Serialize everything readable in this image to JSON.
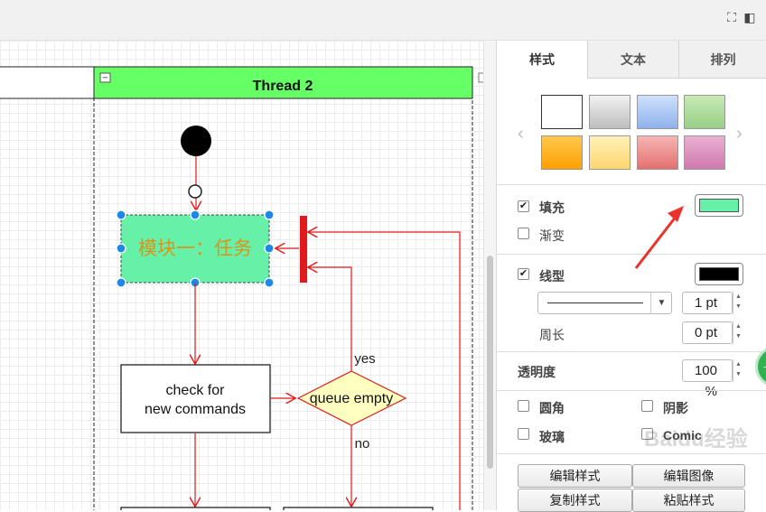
{
  "toolbar": {
    "fullscreen_icon": "fullscreen-icon",
    "panel_toggle_icon": "panel-toggle-icon"
  },
  "diagram": {
    "swimlane_title": "Thread 2",
    "collapse_glyph": "−",
    "selected_task_label": "模块一：任务",
    "check_line1": "check for",
    "check_line2": "new commands",
    "decision_label": "queue empty",
    "yes_label": "yes",
    "no_label": "no",
    "fill_color": "#66f0a8",
    "accent_color": "#e01b1b"
  },
  "format_panel": {
    "tabs": [
      {
        "label": "样式",
        "active": true
      },
      {
        "label": "文本",
        "active": false
      },
      {
        "label": "排列",
        "active": false
      }
    ],
    "fill_label": "填充",
    "fill_checked": true,
    "gradient_label": "渐变",
    "gradient_checked": false,
    "line_label": "线型",
    "line_checked": true,
    "line_width": "1 pt",
    "perimeter_label": "周长",
    "perimeter_value": "0 pt",
    "opacity_label": "透明度",
    "opacity_value": "100 %",
    "rounded_label": "圆角",
    "shadow_label": "阴影",
    "glass_label": "玻璃",
    "comic_label": "Comic",
    "edit_style": "编辑样式",
    "edit_image": "编辑图像",
    "copy_style": "复制样式",
    "paste_style": "粘贴样式",
    "fill_swatch": "#66f0a8",
    "line_swatch": "#000000"
  },
  "watermark": "Baidu经验"
}
